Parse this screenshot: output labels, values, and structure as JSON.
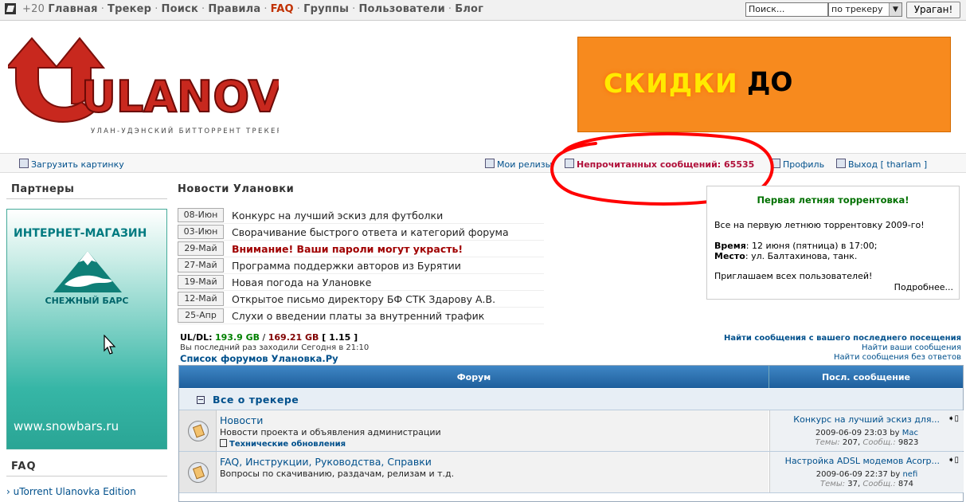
{
  "topnav": {
    "plus": "+20",
    "links": [
      "Главная",
      "Трекер",
      "Поиск",
      "Правила",
      "FAQ",
      "Группы",
      "Пользователи",
      "Блог"
    ],
    "search_placeholder": "Поиск...",
    "search_scope": "по трекеру",
    "search_button": "Ураган!"
  },
  "header": {
    "logo_text": "ULANOVKA",
    "logo_subtitle": "УЛАН-УДЭНСКИЙ БИТТОРРЕНТ ТРЕКЕР",
    "banner_word1": "СКИДКИ",
    "banner_word2": "ДО"
  },
  "userbar": {
    "upload_image": "Загрузить картинку",
    "my_releases": "Мои релизы",
    "unread_messages": "Непрочитанных сообщений: 65535",
    "profile": "Профиль",
    "logout": "Выход [ tharlam ]"
  },
  "sidebar": {
    "partners_title": "Партнеры",
    "ad": {
      "title": "ИНТЕРНЕТ-МАГАЗИН",
      "brand": "СНЕЖНЫЙ БАРС",
      "url": "www.snowbars.ru"
    },
    "faq_title": "FAQ",
    "faq_items": [
      "uTorrent Ulanovka Edition"
    ]
  },
  "news": {
    "title": "Новости Улановки",
    "items": [
      {
        "date": "08-Июн",
        "text": "Конкурс на лучший эскиз для футболки"
      },
      {
        "date": "03-Июн",
        "text": "Сворачивание быстрого ответа и категорий форума"
      },
      {
        "date": "29-Май",
        "text": "Внимание! Ваши пароли могут украсть!"
      },
      {
        "date": "27-Май",
        "text": "Программа поддержки авторов из Бурятии"
      },
      {
        "date": "19-Май",
        "text": "Новая погода на Улановке"
      },
      {
        "date": "12-Май",
        "text": "Открытое письмо директору БФ СТК Здарову А.В."
      },
      {
        "date": "25-Апр",
        "text": "Слухи о введении платы за внутренний трафик"
      }
    ]
  },
  "event": {
    "title": "Первая летняя торрентовка!",
    "line1": "Все на первую летнюю торрентовку 2009-го!",
    "time_label": "Время",
    "time_value": ": 12 июня (пятница) в 17:00;",
    "place_label": "Место",
    "place_value": ": ул. Балтахинова, танк.",
    "line4": "Приглашаем всех пользователей!",
    "more": "Подробнее..."
  },
  "stats": {
    "label": "UL/DL:",
    "upload": "193.9 GB",
    "slash": " / ",
    "download": "169.21 GB",
    "ratio": " [ 1.15 ]",
    "last_visit": "Вы последний раз заходили Сегодня в 21:10",
    "forum_list_link": "Список форумов Улановка.Ру",
    "links": [
      "Найти сообщения с вашего последнего посещения",
      "Найти ваши сообщения",
      "Найти сообщения без ответов"
    ]
  },
  "forum": {
    "col_forum": "Форум",
    "col_last": "Посл. сообщение",
    "category": "Все о трекере",
    "rows": [
      {
        "name": "Новости",
        "desc": "Новости проекта и объявления администрации",
        "sub": "Технические обновления",
        "last_title": "Конкурс на лучший эскиз для...",
        "last_date": "2009-06-09 23:03 by ",
        "last_author": "Mac",
        "topics_label": "Темы:",
        "topics": " 207, ",
        "posts_label": "Сообщ.:",
        "posts": " 9823"
      },
      {
        "name": "FAQ, Инструкции, Руководства, Справки",
        "desc": "Вопросы по скачиванию, раздачам, релизам и т.д.",
        "sub": "",
        "last_title": "Настройка ADSL модемов Acorp...",
        "last_date": "2009-06-09 22:37 by ",
        "last_author": "nefi",
        "topics_label": "Темы:",
        "topics": " 37, ",
        "posts_label": "Сообщ.:",
        "posts": " 874"
      }
    ]
  },
  "colors": {
    "link": "#00508c",
    "banner": "#f78a1e",
    "alert": "#a00000",
    "annotation": "#ff0000"
  }
}
